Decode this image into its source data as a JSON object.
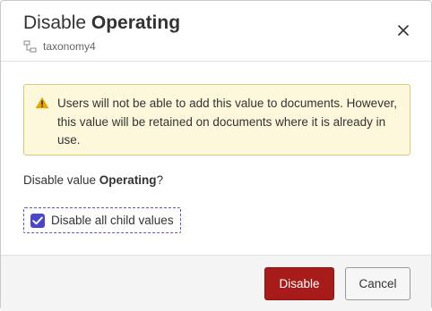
{
  "dialog": {
    "title_prefix": "Disable ",
    "title_value": "Operating",
    "taxonomy_icon": "taxonomy-tree-icon",
    "taxonomy_name": "taxonomy4",
    "close_icon": "close-icon"
  },
  "warning": {
    "icon": "warning-triangle-icon",
    "text": "Users will not be able to add this value to documents. However, this value will be retained on documents where it is already in use."
  },
  "question": {
    "prefix": "Disable value ",
    "value": "Operating",
    "suffix": "?"
  },
  "child_values": {
    "label": "Disable all child values",
    "checked": true
  },
  "footer": {
    "disable_label": "Disable",
    "cancel_label": "Cancel"
  },
  "colors": {
    "primary_button": "#a81b1b",
    "checkbox_accent": "#4a46c8",
    "warning_background": "#fdf8dc",
    "warning_icon": "#e5a400"
  }
}
